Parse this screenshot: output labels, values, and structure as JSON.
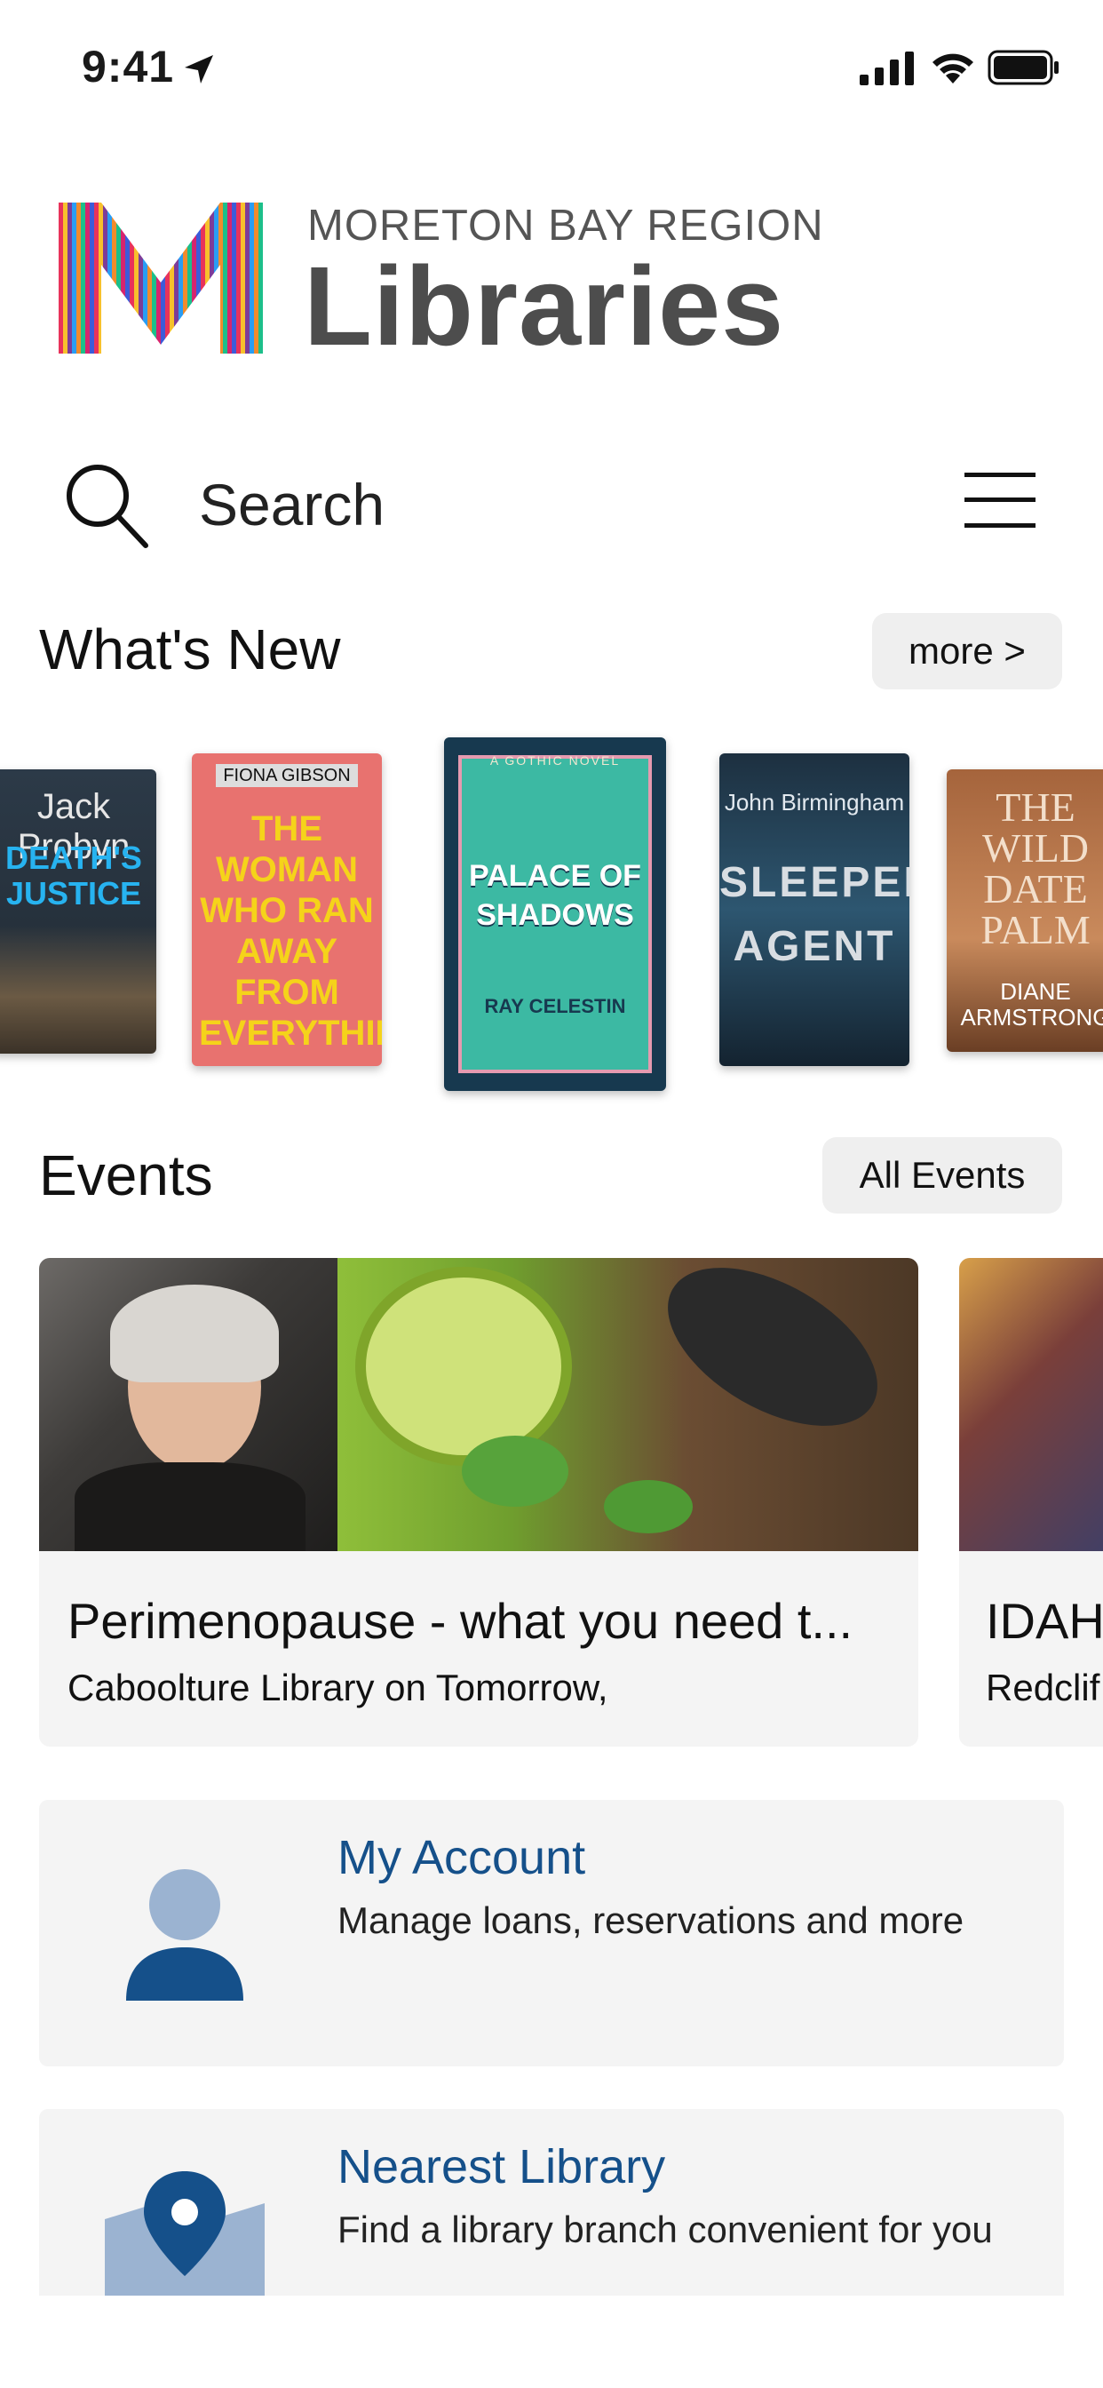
{
  "status_bar": {
    "time": "9:41"
  },
  "brand": {
    "region": "MORETON BAY REGION",
    "name": "Libraries"
  },
  "search": {
    "label": "Search"
  },
  "whats_new": {
    "title": "What's New",
    "more_label": "more >",
    "books": [
      {
        "author": "Jack Probyn",
        "title": "DEATH'S JUSTICE"
      },
      {
        "author": "FIONA GIBSON",
        "title": "THE WOMAN WHO RAN AWAY FROM EVERYTHING"
      },
      {
        "author": "RAY CELESTIN",
        "title": "PALACE OF SHADOWS",
        "tag": "A GOTHIC NOVEL"
      },
      {
        "author": "John Birmingham",
        "title": "SLEEPER AGENT"
      },
      {
        "author": "DIANE ARMSTRONG",
        "title": "THE WILD DATE PALM"
      }
    ]
  },
  "events": {
    "title": "Events",
    "all_label": "All Events",
    "items": [
      {
        "title": "Perimenopause - what you need t...",
        "subtitle": "Caboolture Library on Tomorrow,"
      },
      {
        "title": "IDAH",
        "subtitle": "Redclif"
      }
    ]
  },
  "tiles": [
    {
      "title": "My Account",
      "subtitle": "Manage loans, reservations and more",
      "icon": "person-icon"
    },
    {
      "title": "Nearest Library",
      "subtitle": "Find a library branch convenient for you",
      "icon": "map-pin-icon"
    }
  ],
  "colors": {
    "accent": "#15508a",
    "accent_light": "#9bb3d1",
    "tile_bg": "#f4f4f4"
  }
}
